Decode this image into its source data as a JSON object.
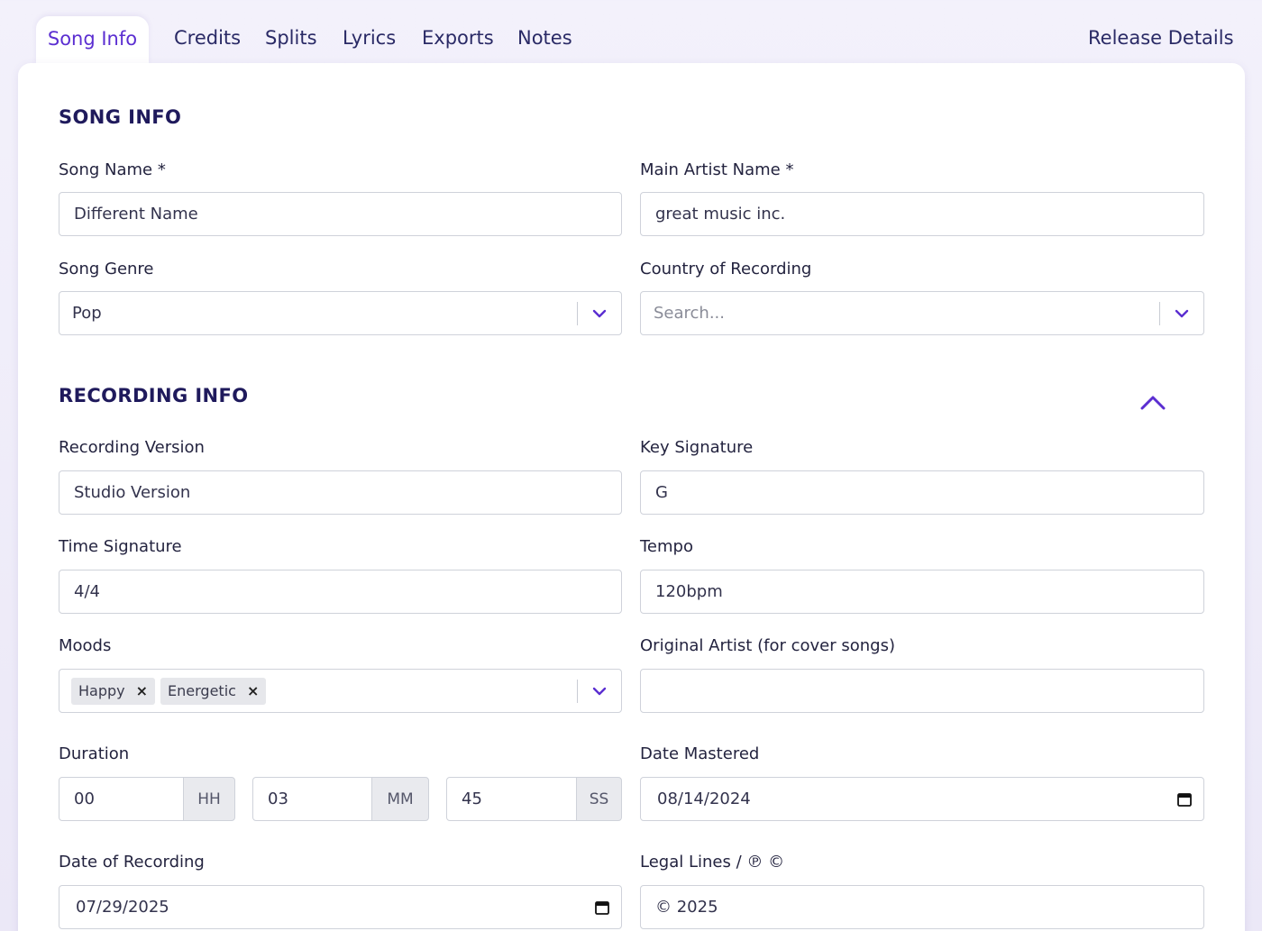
{
  "tabs": {
    "song_info": "Song Info",
    "credits": "Credits",
    "splits": "Splits",
    "lyrics": "Lyrics",
    "exports": "Exports",
    "notes": "Notes",
    "release_details": "Release Details"
  },
  "song_info": {
    "title": "SONG INFO",
    "song_name_label": "Song Name *",
    "song_name_value": "Different Name",
    "main_artist_label": "Main Artist Name *",
    "main_artist_value": "great music inc.",
    "genre_label": "Song Genre",
    "genre_value": "Pop",
    "country_label": "Country of Recording",
    "country_placeholder": "Search..."
  },
  "recording_info": {
    "title": "RECORDING INFO",
    "version_label": "Recording Version",
    "version_value": "Studio Version",
    "key_label": "Key Signature",
    "key_value": "G",
    "time_sig_label": "Time Signature",
    "time_sig_value": "4/4",
    "tempo_label": "Tempo",
    "tempo_value": "120bpm",
    "moods_label": "Moods",
    "moods": [
      "Happy",
      "Energetic"
    ],
    "chip_remove": "×",
    "original_artist_label": "Original Artist (for cover songs)",
    "original_artist_value": "",
    "duration_label": "Duration",
    "duration": {
      "hours": "00",
      "hours_unit": "HH",
      "minutes": "03",
      "minutes_unit": "MM",
      "seconds": "45",
      "seconds_unit": "SS"
    },
    "date_mastered_label": "Date Mastered",
    "date_mastered_value": "08/14/2024",
    "date_recording_label": "Date of Recording",
    "date_recording_value": "07/29/2025",
    "legal_lines_label": "Legal Lines / ℗ ©",
    "legal_lines_value": "© 2025"
  },
  "colors": {
    "accent": "#5b2ed1",
    "heading": "#1f1a5c",
    "border": "#cfd2da"
  }
}
